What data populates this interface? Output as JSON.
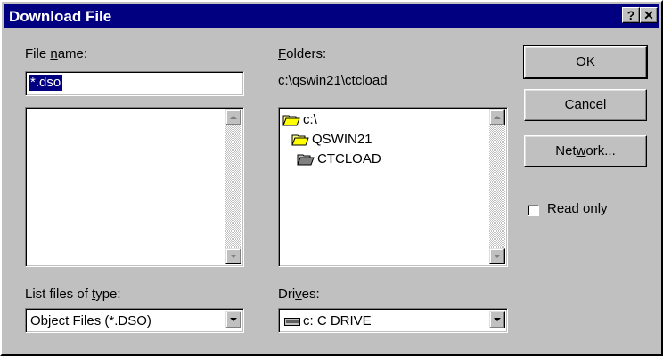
{
  "window": {
    "title": "Download File",
    "help_glyph": "?",
    "close_glyph": "✕"
  },
  "file_name": {
    "label_pre": "File ",
    "label_u": "n",
    "label_post": "ame:",
    "value": "*.dso"
  },
  "folders": {
    "label_u": "F",
    "label_post": "olders:",
    "path": "c:\\qswin21\\ctcload",
    "items": [
      {
        "label": "c:\\",
        "icon": "open-folder-icon"
      },
      {
        "label": "QSWIN21",
        "icon": "open-folder-icon"
      },
      {
        "label": "CTCLOAD",
        "icon": "open-folder-icon"
      }
    ]
  },
  "list_type": {
    "label_pre": "List files of ",
    "label_u": "t",
    "label_post": "ype:",
    "value": "Object Files (*.DSO)"
  },
  "drives": {
    "label_pre": "Dri",
    "label_u": "v",
    "label_post": "es:",
    "value": "c: C DRIVE",
    "icon": "drive-icon"
  },
  "buttons": {
    "ok": "OK",
    "cancel": "Cancel",
    "network_pre": "Net",
    "network_u": "w",
    "network_post": "ork..."
  },
  "read_only": {
    "label_u": "R",
    "label_post": "ead only",
    "checked": false
  }
}
